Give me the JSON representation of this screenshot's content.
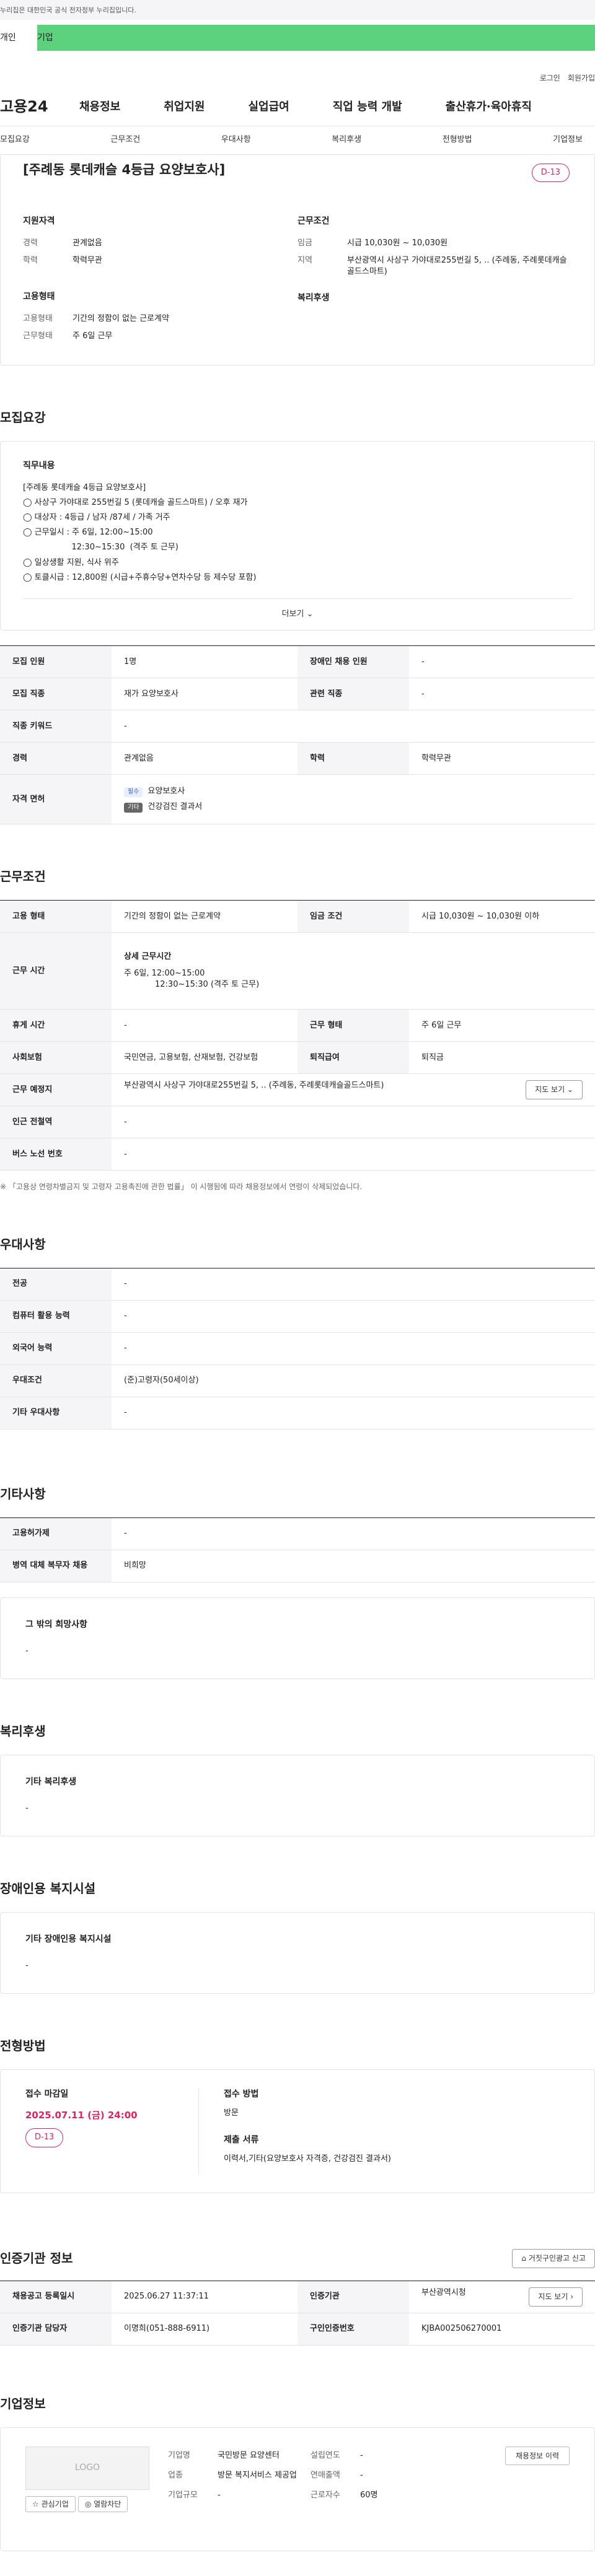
{
  "topbar": {
    "notice": "누리집은 대한민국 공식 전자정부 누리집입니다."
  },
  "tabs": {
    "personal": "개인",
    "corporate": "기업"
  },
  "util": {
    "login": "로그인",
    "join": "회원가입"
  },
  "gnb": {
    "logo": "고용24",
    "items": [
      "채용정보",
      "취업지원",
      "실업급여",
      "직업 능력 개발",
      "출산휴가·육아휴직"
    ]
  },
  "anchor": [
    "모집요강",
    "근무조건",
    "우대사항",
    "복리후생",
    "전형방법",
    "기업정보"
  ],
  "summary": {
    "title": "[주례동 롯데캐슬 4등급 요양보호사]",
    "dday": "D-13",
    "qual_h": "지원자격",
    "career_k": "경력",
    "career_v": "관계없음",
    "edu_k": "학력",
    "edu_v": "학력무관",
    "cond_h": "근무조건",
    "wage_k": "임금",
    "wage_v": "시급 10,030원 ~ 10,030원",
    "area_k": "지역",
    "area_v": "부산광역시 사상구 가야대로255번길 5, .. (주례동, 주례롯데캐슬골드스마트)",
    "emp_h": "고용형태",
    "emptype_k": "고용형태",
    "emptype_v": "기간의 정함이 없는 근로계약",
    "workform_k": "근무형태",
    "workform_v": "주 6일 근무",
    "welfare_h": "복리후생"
  },
  "recruit": {
    "title": "모집요강",
    "duty_h": "직무내용",
    "duty_lines": [
      "[주례동 롯데캐슬 4등급 요양보호사]",
      "",
      "◯ 사상구 가야대로 255번길 5 (롯데캐슬 골드스마트) / 오후 재가",
      "◯ 대상자 : 4등급 / 남자 /87세 / 가족 거주",
      "◯ 근무일시 : 주 6일, 12:00~15:00",
      "                   12:30~15:30  (격주 토 근무)",
      "◯ 일상생활 지원, 식사 위주",
      "◯ 토클시급 : 12,800원 (시급+주휴수당+연차수당 등 제수당 포함)"
    ],
    "more": "더보기 ⌄",
    "rows": {
      "people_k": "모집 인원",
      "people_v": "1명",
      "disabled_k": "장애인 채용 인원",
      "disabled_v": "-",
      "job_k": "모집 직종",
      "job_v": "재가 요양보호사",
      "related_k": "관련 직종",
      "related_v": "-",
      "keyword_k": "직종 키워드",
      "keyword_v": "-",
      "career_k": "경력",
      "career_v": "관계없음",
      "edu_k": "학력",
      "edu_v": "학력무관",
      "license_k": "자격 면허",
      "license_badge1": "필수",
      "license_v1": "요양보호사",
      "license_badge2": "기타",
      "license_v2": "건강검진 결과서"
    }
  },
  "work": {
    "title": "근무조건",
    "emptype_k": "고용 형태",
    "emptype_v": "기간의 정함이 없는 근로계약",
    "wage_k": "임금 조건",
    "wage_v": "시급 10,030원 ~ 10,030원 이하",
    "time_k": "근무 시간",
    "time_h": "상세 근무시간",
    "time_v1": "주 6일, 12:00~15:00",
    "time_v2": "12:30~15:30 (격주 토 근무)",
    "rest_k": "휴게 시간",
    "rest_v": "-",
    "form_k": "근무 형태",
    "form_v": "주 6일 근무",
    "ins_k": "사회보험",
    "ins_v": "국민연금, 고용보험, 산재보험, 건강보험",
    "retire_k": "퇴직급여",
    "retire_v": "퇴직금",
    "place_k": "근무 예정지",
    "place_v": "부산광역시 사상구 가야대로255번길 5, .. (주례동, 주례롯데캐슬골드스마트)",
    "map_btn": "지도 보기 ⌄",
    "subway_k": "인근 전철역",
    "subway_v": "-",
    "bus_k": "버스 노선 번호",
    "bus_v": "-",
    "note": "※ 「고용상 연령차별금지 및 고령자 고용촉진에 관한 법률」 이 시행됨에 따라 채용정보에서 연령이 삭제되었습니다."
  },
  "pref": {
    "title": "우대사항",
    "major_k": "전공",
    "major_v": "-",
    "pc_k": "컴퓨터 활용 능력",
    "pc_v": "-",
    "lang_k": "외국어 능력",
    "lang_v": "-",
    "pref_k": "우대조건",
    "pref_v": "(준)고령자(50세이상)",
    "etc_k": "기타 우대사항",
    "etc_v": "-"
  },
  "other": {
    "title": "기타사항",
    "permit_k": "고용허가제",
    "permit_v": "-",
    "military_k": "병역 대체 복무자 채용",
    "military_v": "비희망",
    "hope_h": "그 밖의 희망사항",
    "hope_v": "-"
  },
  "welfare": {
    "title": "복리후생",
    "h": "기타 복리후생",
    "v": "-"
  },
  "disabled": {
    "title": "장애인용 복지시설",
    "h": "기타 장애인용 복지시설",
    "v": "-"
  },
  "process": {
    "title": "전형방법",
    "deadline_h": "접수 마감일",
    "deadline_v": "2025.07.11 (금) 24:00",
    "dday": "D-13",
    "method_h": "접수 방법",
    "method_v": "방문",
    "docs_h": "제출 서류",
    "docs_v": "이력서,기타(요양보호사 자격증, 건강검진 결과서)"
  },
  "agency": {
    "title": "인증기관 정보",
    "report_btn": "⌂ 거짓구인광고 신고",
    "reg_k": "채용공고 등록일시",
    "reg_v": "2025.06.27 11:37:11",
    "org_k": "인증기관",
    "org_v": "부산광역시청",
    "map_btn": "지도 보기 ›",
    "mgr_k": "인증기관 담당자",
    "mgr_v": "이명희(051-888-6911)",
    "num_k": "구인인증번호",
    "num_v": "KJBA002506270001"
  },
  "company": {
    "title": "기업정보",
    "logo": "LOGO",
    "fav_btn": "☆ 관심기업",
    "block_btn": "◎ 열람차단",
    "name_k": "기업명",
    "name_v": "국민방문 요양센터",
    "year_k": "설립연도",
    "year_v": "-",
    "history_btn": "채용정보 이력",
    "sales_k": "연매출액",
    "sales_v": "-",
    "industry_k": "업종",
    "industry_v": "방문 복지서비스 제공업",
    "staff_k": "근로자수",
    "staff_v": "60명",
    "size_k": "기업규모",
    "size_v": "-"
  },
  "colors": {
    "accent": "#5cd17e",
    "dday": "#e0245e"
  }
}
